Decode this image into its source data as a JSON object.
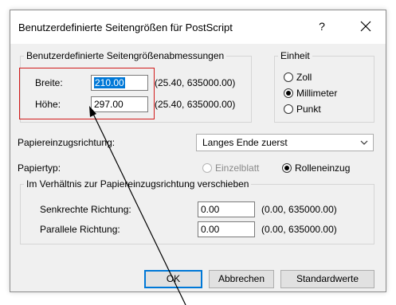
{
  "dialog": {
    "title": "Benutzerdefinierte Seitengrößen für PostScript",
    "help_label": "?"
  },
  "dimensions": {
    "group_label": "Benutzerdefinierte Seitengrößenabmessungen",
    "width_label": "Breite:",
    "width_value": "210.00",
    "width_range": "(25.40, 635000.00)",
    "height_label": "Höhe:",
    "height_value": "297.00",
    "height_range": "(25.40, 635000.00)"
  },
  "unit": {
    "group_label": "Einheit",
    "options": [
      "Zoll",
      "Millimeter",
      "Punkt"
    ],
    "selected": "Millimeter"
  },
  "feed": {
    "direction_label": "Papiereinzugsrichtung:",
    "direction_value": "Langes Ende zuerst",
    "paper_type_label": "Papiertyp:",
    "paper_type_options": [
      "Einzelblatt",
      "Rolleneinzug"
    ],
    "paper_type_selected": "Rolleneinzug"
  },
  "offset": {
    "group_label": "Im Verhältnis zur Papiereinzugsrichtung verschieben",
    "vertical_label": "Senkrechte Richtung:",
    "vertical_value": "0.00",
    "vertical_range": "(0.00, 635000.00)",
    "parallel_label": "Parallele Richtung:",
    "parallel_value": "0.00",
    "parallel_range": "(0.00, 635000.00)"
  },
  "buttons": {
    "ok": "OK",
    "cancel": "Abbrechen",
    "defaults": "Standardwerte"
  },
  "colors": {
    "accent": "#0078d7",
    "highlight_box": "#d11a1a"
  }
}
